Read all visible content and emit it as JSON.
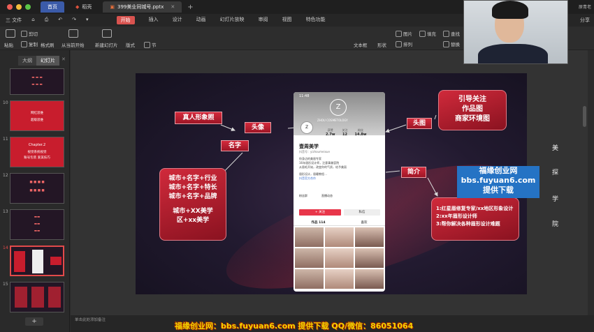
{
  "titlebar": {
    "tabs": [
      {
        "label": "首页",
        "kind": "home"
      },
      {
        "label": "稻壳",
        "kind": "normal"
      },
      {
        "label": "399美业同城号.pptx",
        "kind": "active"
      }
    ],
    "right_text": "原青老"
  },
  "menubar": {
    "left": [
      "三 文件",
      "⌂",
      "⎙",
      "↶",
      "↷",
      "▾"
    ],
    "tabs": [
      "开始",
      "插入",
      "设计",
      "动画",
      "幻灯片放映",
      "审阅",
      "视图",
      "特色功能"
    ],
    "active_tab": "开始",
    "share": "分享"
  },
  "ribbon": {
    "paste": "粘贴",
    "cut": "剪切",
    "copy": "复制",
    "format_painter": "格式刷",
    "from_current": "从当前开始",
    "new_slide": "新建幻灯片",
    "layout": "版式",
    "section": "节",
    "textbox": "文本框",
    "shape": "形状",
    "arrange": "排列",
    "picture": "图片",
    "fill": "填充",
    "find": "查找",
    "replace": "替换"
  },
  "left_panel": {
    "tabs": [
      "大纲",
      "幻灯片"
    ],
    "active_tab": "幻灯片",
    "slide_numbers": [
      "10",
      "11",
      "12",
      "13",
      "14",
      "15"
    ],
    "slide10_text": [
      "网红思维",
      "超级思维"
    ],
    "slide11_text": [
      "Chapter.2",
      "视觉系统视觉",
      "账号包装 爱美技巧"
    ],
    "add_slide": "+"
  },
  "slide": {
    "label_real_photo": "真人形象照",
    "label_avatar": "头像",
    "label_name": "名字",
    "label_header_image": "头图",
    "label_intro": "简介",
    "box_header_image": [
      "引导关注",
      "作品图",
      "商家环境图"
    ],
    "box_name": [
      "城市+名字+行业",
      "城市+名字+特长",
      "城市+名字+品牌",
      "",
      "城市+XX美学",
      "区+xx美学"
    ],
    "box_intro": [
      "1:红星眉修复专家/xx地区形象设计",
      "2:xx年眉形设计师",
      "3:帮你解决各种眉形设计难题"
    ],
    "side_chars": [
      "美",
      "探",
      "学",
      "院"
    ],
    "arrow_color": "#d9d9d9"
  },
  "phone": {
    "time": "11:48",
    "logo": "Z",
    "brand": "ZHOU COSMETOLOGY",
    "stats": [
      {
        "value": "2.7w",
        "label": "获赞"
      },
      {
        "value": "12",
        "label": "关注"
      },
      {
        "value": "14.8w",
        "label": "粉丝"
      }
    ],
    "name": "壹周美学",
    "id": "抖音号：yizhoumeixue",
    "bio": [
      "你身边的美眉专家",
      "16年眉形设计师，注意事美容院",
      "从眉毛开始，改变你的气质，给予美丽",
      "",
      "眉形设计，眉睫教程…"
    ],
    "official": "抖音官方合作",
    "row": [
      "粉丝群",
      "直播动态"
    ],
    "follow": "+ 关注",
    "message": "私信",
    "works": "作品 114",
    "likes_tab": "喜欢"
  },
  "watermark": {
    "line1": "福缘创业网",
    "line2": "bbs.fuyuan6.com",
    "line3": "提供下载"
  },
  "statusbar": {
    "note": "单击此处添加备注",
    "banner": "福缘创业网：bbs.fuyuan6.com 提供下载 QQ/微信：86051064"
  },
  "colors": {
    "accent_red": "#d42a3c",
    "ribbon_active": "#d9534f",
    "watermark_blue": "#2573c4",
    "banner_yellow": "#f3d600"
  }
}
